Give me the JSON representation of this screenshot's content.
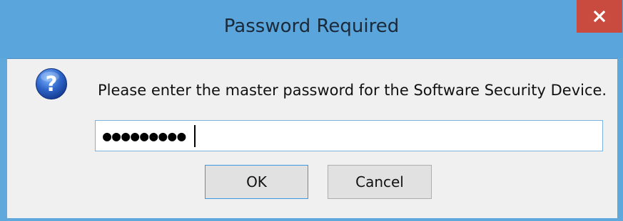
{
  "dialog": {
    "title": "Password Required",
    "close_icon": "close-icon",
    "question_icon": "question-icon",
    "message": "Please enter the master password for the Software Security Device.",
    "password_value": "●●●●●●●●●",
    "ok_label": "OK",
    "cancel_label": "Cancel"
  },
  "colors": {
    "titlebar": "#5aa5db",
    "close_button": "#c94b3f",
    "client_background": "#f0f0f0",
    "default_button_border": "#3c98e0"
  }
}
